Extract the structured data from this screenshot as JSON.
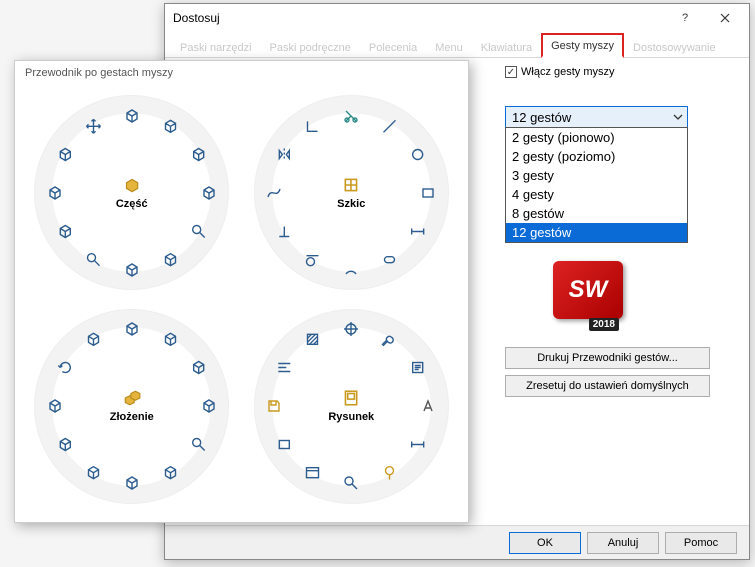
{
  "window": {
    "title": "Dostosuj"
  },
  "tabs": [
    {
      "label": "Paski narzędzi"
    },
    {
      "label": "Paski podręczne"
    },
    {
      "label": "Polecenia"
    },
    {
      "label": "Menu"
    },
    {
      "label": "Klawiatura"
    },
    {
      "label": "Gesty myszy",
      "active": true
    },
    {
      "label": "Dostosowywanie"
    }
  ],
  "checkbox": {
    "label": "Włącz gesty myszy",
    "checked": true
  },
  "select": {
    "value": "12 gestów",
    "options": [
      "2 gesty (pionowo)",
      "2 gesty (poziomo)",
      "3 gesty",
      "4 gesty",
      "8 gestów",
      "12 gestów"
    ],
    "selected_index": 5
  },
  "logo": {
    "text": "SW",
    "year": "2018"
  },
  "side_buttons": {
    "print": "Drukuj Przewodniki gestów...",
    "reset": "Zresetuj do ustawień domyślnych"
  },
  "footer": {
    "ok": "OK",
    "cancel": "Anuluj",
    "help": "Pomoc"
  },
  "guide": {
    "title": "Przewodnik po gestach myszy",
    "rings": [
      {
        "label": "Część",
        "center_icon": "part-icon",
        "slots": [
          "cube-icon",
          "cube-icon",
          "cube-icon",
          "cube-icon",
          "zoom-icon",
          "cube-icon",
          "cube-icon",
          "zoom-icon",
          "cube-icon",
          "cube-icon",
          "cube-icon",
          "move-icon"
        ]
      },
      {
        "label": "Szkic",
        "center_icon": "sketch-icon",
        "slots": [
          "trim-icon",
          "line-icon",
          "circle-icon",
          "rect-icon",
          "dim-icon",
          "slot-icon",
          "arc-icon",
          "tangent-icon",
          "perp-icon",
          "spline-icon",
          "mirror-icon",
          "corner-icon"
        ]
      },
      {
        "label": "Złożenie",
        "center_icon": "assembly-icon",
        "slots": [
          "cube-icon",
          "cube-icon",
          "cube-icon",
          "cube-icon",
          "zoom-icon",
          "cube-icon",
          "cube-icon",
          "cube-icon",
          "cube-icon",
          "cube-icon",
          "rotate-icon",
          "cube-icon"
        ]
      },
      {
        "label": "Rysunek",
        "center_icon": "drawing-icon",
        "slots": [
          "center-icon",
          "wrench-icon",
          "note-icon",
          "font-icon",
          "dim-icon",
          "balloon-icon",
          "zoom-icon",
          "window-icon",
          "rect-icon",
          "save-icon",
          "align-icon",
          "hatch-icon"
        ]
      }
    ]
  }
}
